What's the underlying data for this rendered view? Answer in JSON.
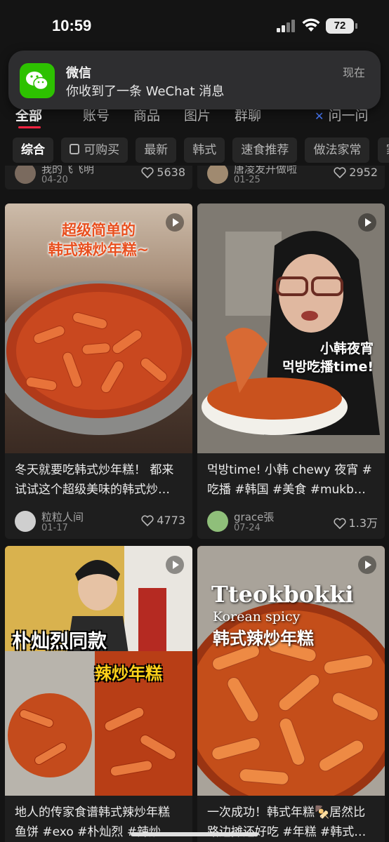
{
  "status_bar": {
    "time": "10:59",
    "battery": "72"
  },
  "notification": {
    "app": "微信",
    "message": "你收到了一条 WeChat 消息",
    "time": "现在"
  },
  "tabs": [
    "全部",
    "账号",
    "商品",
    "图片",
    "群聊",
    "问一问"
  ],
  "chips": [
    "综合",
    "可购买",
    "最新",
    "韩式",
    "速食推荐",
    "做法家常",
    "家"
  ],
  "partial_cards": [
    {
      "author": "我的飞飞明",
      "date": "04-20",
      "likes": "5638"
    },
    {
      "author": "唐凌发开做啦",
      "date": "01-25",
      "likes": "2952"
    }
  ],
  "cards": [
    {
      "overlay": [
        "超级简单的",
        "韩式辣炒年糕~"
      ],
      "title_lines": [
        "冬天就要吃韩式炒年糕！ 都来",
        "试试这个超级美味的韩式炒…"
      ],
      "author": "粒粒人间",
      "date": "01-17",
      "likes": "4773"
    },
    {
      "overlay": [
        "小韩夜宵",
        "먹방吃播time!"
      ],
      "title_lines": [
        "먹방time! 小韩 chewy 夜宵 #",
        "吃播 #韩国 #美食 #mukb…"
      ],
      "author": "grace張",
      "date": "07-24",
      "likes": "1.3万"
    },
    {
      "overlay": [
        "朴灿烈同款",
        "辣炒年糕"
      ],
      "title_lines": [
        "地人的传家食谱韩式辣炒年糕",
        "鱼饼 #exo #朴灿烈 #辣炒…"
      ]
    },
    {
      "overlay": [
        "Tteokbokki",
        "Korean spicy",
        "韩式辣炒年糕"
      ],
      "title_lines": [
        "一次成功！韩式年糕🍢居然比",
        "路边摊还好吃 #年糕 #韩式…"
      ]
    }
  ],
  "colors": {
    "accent": "#ff2442",
    "background": "#141414",
    "card": "#1e1e1e",
    "wechat_green": "#2dc100"
  }
}
